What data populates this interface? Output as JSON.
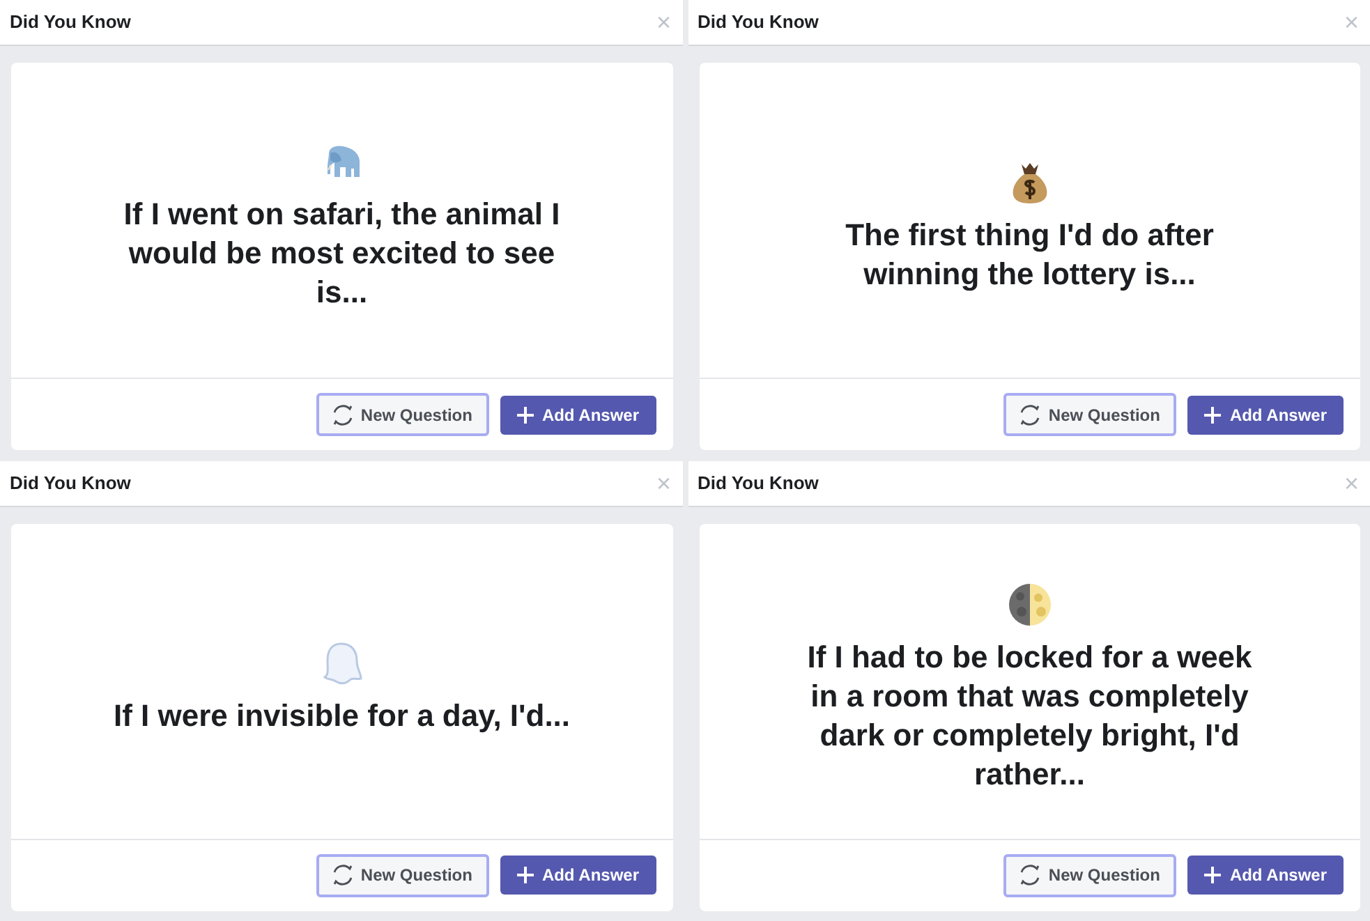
{
  "panels": [
    {
      "title": "Did You Know",
      "close": "×",
      "question": "If I went on safari, the animal I would be most excited to see is...",
      "new_question": "New Question",
      "add_answer": "Add Answer"
    },
    {
      "title": "Did You Know",
      "close": "×",
      "question": "The first thing I'd do after winning the lottery is...",
      "new_question": "New Question",
      "add_answer": "Add Answer"
    },
    {
      "title": "Did You Know",
      "close": "×",
      "question": "If I were invisible for a day, I'd...",
      "new_question": "New Question",
      "add_answer": "Add Answer"
    },
    {
      "title": "Did You Know",
      "close": "×",
      "question": "If I had to be locked for a week in a room that was completely dark or completely bright, I'd rather...",
      "new_question": "New Question",
      "add_answer": "Add Answer"
    }
  ]
}
